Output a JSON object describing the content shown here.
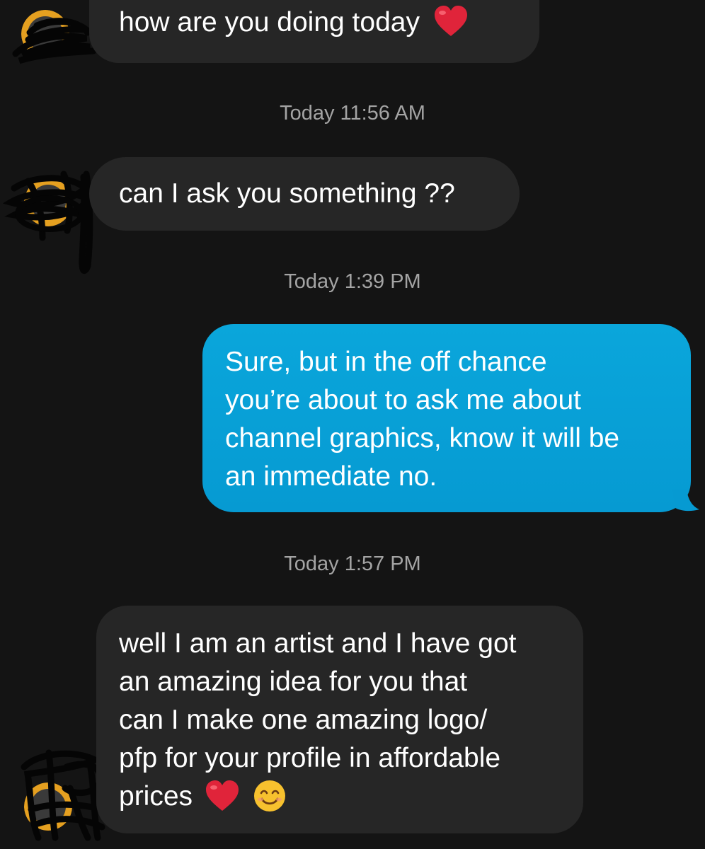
{
  "messages": [
    {
      "id": "m1",
      "direction": "incoming",
      "text": "how are you doing today",
      "emojis": [
        "red-heart"
      ]
    },
    {
      "id": "ts1",
      "type": "timestamp",
      "text": "Today 11:56 AM"
    },
    {
      "id": "m2",
      "direction": "incoming",
      "text": "can I ask you something ??"
    },
    {
      "id": "ts2",
      "type": "timestamp",
      "text": "Today 1:39 PM"
    },
    {
      "id": "m3",
      "direction": "outgoing",
      "lines": [
        "Sure, but in the off chance",
        "you’re about to ask me about",
        "channel graphics, know it will be",
        "an immediate no."
      ]
    },
    {
      "id": "ts3",
      "type": "timestamp",
      "text": "Today 1:57 PM"
    },
    {
      "id": "m4",
      "direction": "incoming",
      "lines": [
        "well I am an artist and I have got",
        "an amazing idea for you that",
        "can I make one amazing logo/",
        "pfp for your profile in affordable",
        "prices"
      ],
      "emojis": [
        "red-heart",
        "smiling-face"
      ]
    }
  ],
  "colors": {
    "background": "#141414",
    "incoming_bubble": "#262626",
    "outgoing_bubble": "#0a9fd6",
    "timestamp": "#a4a4a4",
    "heart": "#e0243a",
    "smiley": "#f7c12e"
  }
}
